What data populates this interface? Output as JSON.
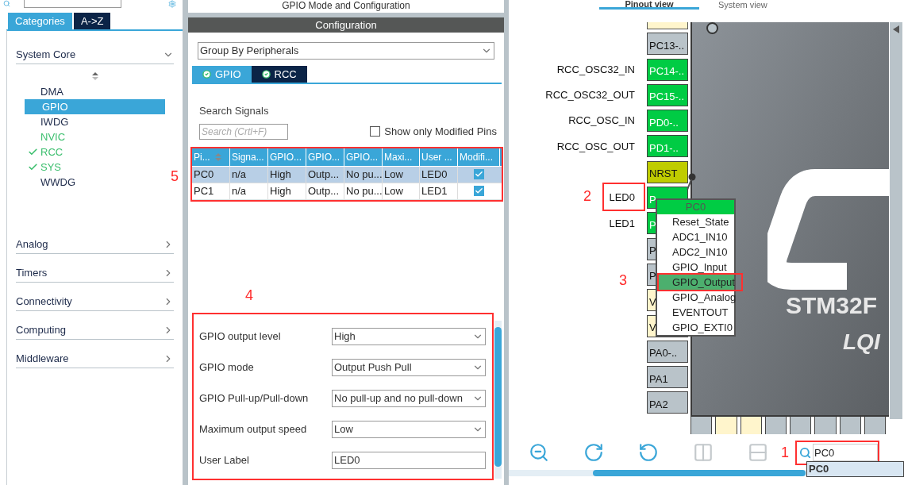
{
  "sidebar": {
    "tabs": [
      {
        "label": "Categories",
        "selected": true
      },
      {
        "label": "A->Z",
        "selected": false
      }
    ],
    "categories": [
      {
        "label": "System Core",
        "expanded": true,
        "items": [
          {
            "label": "DMA",
            "selected": false,
            "configured": false,
            "checked": false
          },
          {
            "label": "GPIO",
            "selected": true,
            "configured": false,
            "checked": false
          },
          {
            "label": "IWDG",
            "selected": false,
            "configured": false,
            "checked": false
          },
          {
            "label": "NVIC",
            "selected": false,
            "configured": true,
            "checked": false
          },
          {
            "label": "RCC",
            "selected": false,
            "configured": true,
            "checked": true
          },
          {
            "label": "SYS",
            "selected": false,
            "configured": true,
            "checked": true
          },
          {
            "label": "WWDG",
            "selected": false,
            "configured": false,
            "checked": false
          }
        ]
      },
      {
        "label": "Analog",
        "expanded": false
      },
      {
        "label": "Timers",
        "expanded": false
      },
      {
        "label": "Connectivity",
        "expanded": false
      },
      {
        "label": "Computing",
        "expanded": false
      },
      {
        "label": "Middleware",
        "expanded": false
      }
    ]
  },
  "middle": {
    "title": "GPIO Mode and Configuration",
    "section": "Configuration",
    "group_by": "Group By Peripherals",
    "tabs": [
      {
        "label": "GPIO",
        "selected": true
      },
      {
        "label": "RCC",
        "selected": false
      }
    ],
    "search_label": "Search Signals",
    "search_placeholder": "Search (Crtl+F)",
    "modified_only": {
      "label": "Show only Modified Pins",
      "checked": false
    },
    "table": {
      "columns": [
        "Pi...",
        "Signa...",
        "GPIO...",
        "GPIO...",
        "GPIO...",
        "Maxi...",
        "User ...",
        "Modifi..."
      ],
      "rows": [
        {
          "selected": true,
          "cells": [
            "PC0",
            "n/a",
            "High",
            "Outp...",
            "No pu...",
            "Low",
            "LED0"
          ],
          "modified": true
        },
        {
          "selected": false,
          "cells": [
            "PC1",
            "n/a",
            "High",
            "Outp...",
            "No pu...",
            "Low",
            "LED1"
          ],
          "modified": true
        }
      ]
    },
    "form": [
      {
        "kind": "select",
        "label": "GPIO output level",
        "value": "High"
      },
      {
        "kind": "select",
        "label": "GPIO mode",
        "value": "Output Push Pull"
      },
      {
        "kind": "select",
        "label": "GPIO Pull-up/Pull-down",
        "value": "No pull-up and no pull-down"
      },
      {
        "kind": "select",
        "label": "Maximum output speed",
        "value": "Low"
      },
      {
        "kind": "text",
        "label": "User Label",
        "value": "LED0"
      }
    ]
  },
  "pinout": {
    "tabs": [
      {
        "label": "Pinout view",
        "selected": true
      },
      {
        "label": "System view",
        "selected": false
      }
    ],
    "pins": [
      {
        "name": "PC13-..",
        "color": "#b9c3c9"
      },
      {
        "name": "PC14-..",
        "signal": "RCC_OSC32_IN",
        "color": "#00cc44"
      },
      {
        "name": "PC15-..",
        "signal": "RCC_OSC32_OUT",
        "color": "#00cc44"
      },
      {
        "name": "PD0-..",
        "signal": "RCC_OSC_IN",
        "color": "#00cc44"
      },
      {
        "name": "PD1-..",
        "signal": "RCC_OSC_OUT",
        "color": "#00cc44"
      },
      {
        "name": "NRST",
        "color": "#bfcc00"
      },
      {
        "name": "P",
        "signal": "LED0",
        "color": "#00cc44"
      },
      {
        "name": "P",
        "signal": "LED1",
        "color": "#00cc44"
      },
      {
        "name": "P",
        "color": "#b9c3c9"
      },
      {
        "name": "P",
        "color": "#b9c3c9"
      },
      {
        "name": "V",
        "color": "#fff5cc"
      },
      {
        "name": "V",
        "color": "#fff5cc"
      },
      {
        "name": "PA0-..",
        "color": "#b9c3c9"
      },
      {
        "name": "PA1",
        "color": "#b9c3c9"
      },
      {
        "name": "PA2",
        "color": "#b9c3c9"
      }
    ],
    "bottom_pins": [
      {
        "color": "#b9c3c9"
      },
      {
        "color": "#fff5cc"
      },
      {
        "color": "#fff5cc"
      },
      {
        "color": "#b9c3c9"
      },
      {
        "color": "#b9c3c9"
      },
      {
        "color": "#b9c3c9"
      },
      {
        "color": "#b9c3c9"
      },
      {
        "color": "#b9c3c9"
      }
    ],
    "chip_name": "STM32F",
    "package": "LQI",
    "pin_menu": {
      "title": "PC0",
      "items": [
        {
          "label": "Reset_State",
          "selected": false
        },
        {
          "label": "ADC1_IN10",
          "selected": false
        },
        {
          "label": "ADC2_IN10",
          "selected": false
        },
        {
          "label": "GPIO_Input",
          "selected": false
        },
        {
          "label": "GPIO_Output",
          "selected": true
        },
        {
          "label": "GPIO_Analog",
          "selected": false
        },
        {
          "label": "EVENTOUT",
          "selected": false
        },
        {
          "label": "GPIO_EXTI0",
          "selected": false
        }
      ]
    },
    "tools": [
      {
        "kind": "zoom-out",
        "disabled": false
      },
      {
        "kind": "rotate-right",
        "disabled": false
      },
      {
        "kind": "rotate-left",
        "disabled": false
      },
      {
        "kind": "split-vertical",
        "disabled": true
      },
      {
        "kind": "split-horizontal",
        "disabled": true
      }
    ],
    "search": {
      "value": "PC0",
      "suggestions": [
        "PC0"
      ]
    }
  },
  "annotations": {
    "search": "1",
    "pin": "2",
    "menu": "3",
    "form": "4",
    "table": "5"
  }
}
